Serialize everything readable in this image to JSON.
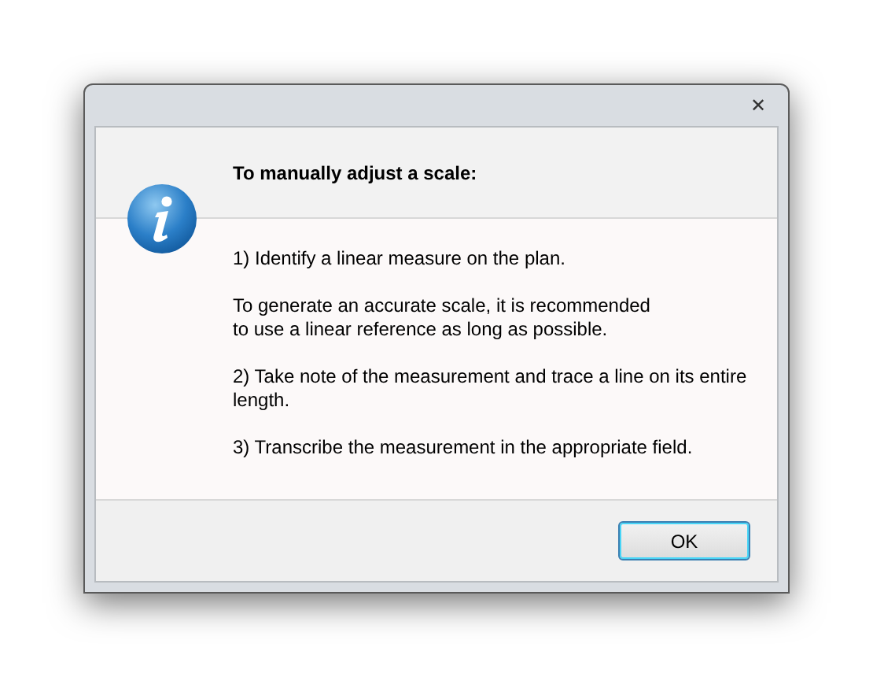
{
  "window": {
    "close_glyph": "✕"
  },
  "heading": "To manually adjust a scale:",
  "paragraphs": [
    {
      "lines": [
        "1) Identify a linear measure on the plan."
      ]
    },
    {
      "lines": [
        "To generate an accurate scale, it is recommended",
        "to use a linear reference as long as possible."
      ]
    },
    {
      "lines": [
        "2) Take note of the measurement and trace a line on its entire",
        "length."
      ]
    },
    {
      "lines": [
        "3) Transcribe the measurement in the appropriate field."
      ]
    }
  ],
  "buttons": [
    {
      "label": "OK",
      "default": true
    }
  ]
}
